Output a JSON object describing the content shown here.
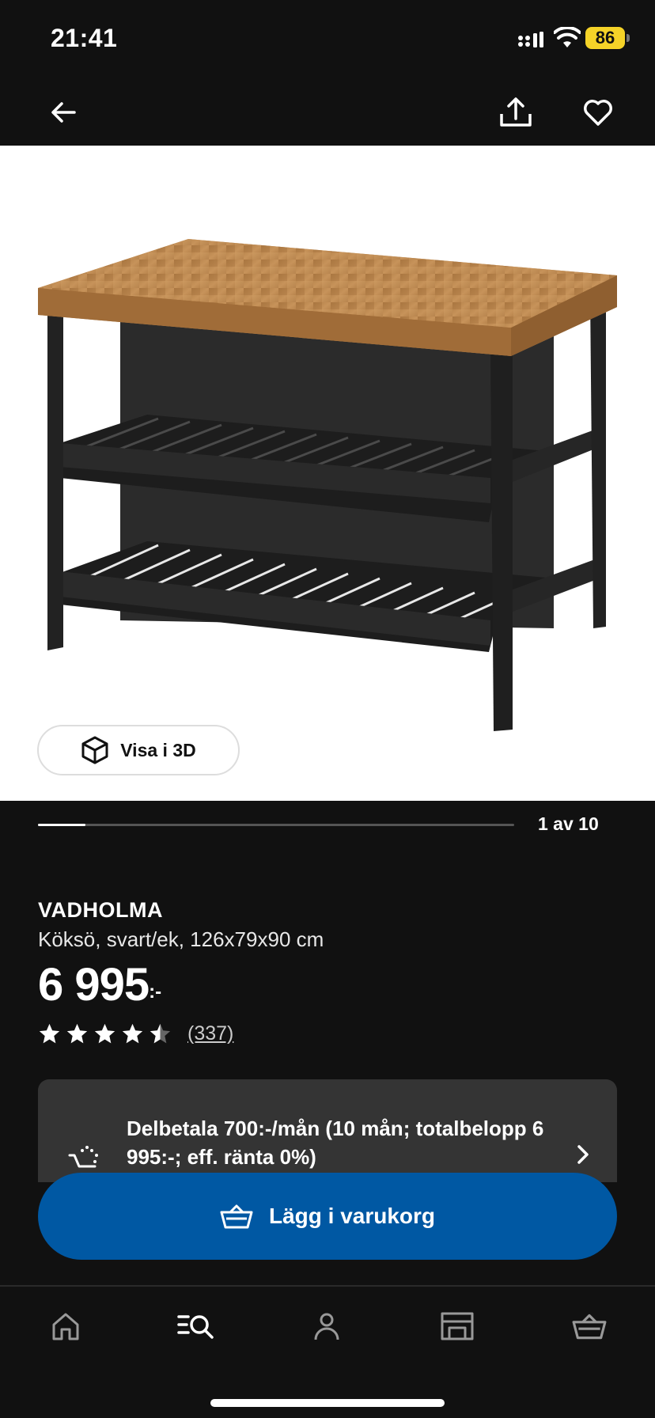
{
  "status_bar": {
    "time": "21:41",
    "battery": "86",
    "battery_color": "#f5d328",
    "icons": [
      "signal-icon",
      "wifi-icon",
      "battery-icon"
    ]
  },
  "header": {
    "back_icon": "arrow-left-icon",
    "share_icon": "share-icon",
    "favorite_icon": "heart-icon"
  },
  "gallery": {
    "view_3d_label": "Visa i 3D",
    "view_3d_icon": "cube-icon",
    "counter": "1 av 10",
    "current": 1,
    "total": 10
  },
  "product": {
    "name": "VADHOLMA",
    "description": "Köksö, svart/ek, 126x79x90 cm",
    "price": "6 995",
    "price_suffix": ":-",
    "rating": 4.5,
    "rating_max": 5,
    "review_count": "(337)"
  },
  "payment": {
    "text": "Delbetala 700:-/mån (10 mån; totalbelopp 6 995:-; eff. ränta 0%)",
    "icon": "installment-icon"
  },
  "cart_button": {
    "label": "Lägg i varukorg",
    "icon": "basket-icon",
    "color": "#0058a3"
  },
  "tab_bar": {
    "items": [
      {
        "icon": "home-icon"
      },
      {
        "icon": "search-list-icon"
      },
      {
        "icon": "profile-icon"
      },
      {
        "icon": "store-icon"
      },
      {
        "icon": "basket-icon"
      }
    ]
  }
}
